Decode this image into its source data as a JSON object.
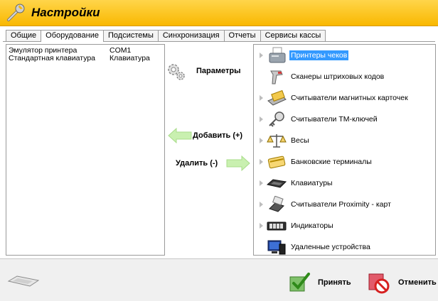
{
  "window": {
    "title": "Настройки"
  },
  "tabs": [
    {
      "label": "Общие",
      "active": false
    },
    {
      "label": "Оборудование",
      "active": true
    },
    {
      "label": "Подсистемы",
      "active": false
    },
    {
      "label": "Синхронизация",
      "active": false
    },
    {
      "label": "Отчеты",
      "active": false
    },
    {
      "label": "Сервисы кассы",
      "active": false
    }
  ],
  "devices": [
    {
      "name": "Эмулятор принтера",
      "port": "COM1"
    },
    {
      "name": "Стандартная клавиатура",
      "port": "Клавиатура"
    }
  ],
  "actions": {
    "params": "Параметры",
    "add": "Добавить (+)",
    "remove": "Удалить (-)"
  },
  "categories": [
    {
      "label": "Принтеры чеков",
      "icon": "receipt-printer-icon",
      "selected": true
    },
    {
      "label": "Сканеры штриховых кодов",
      "icon": "barcode-scanner-icon",
      "selected": false
    },
    {
      "label": "Считыватели магнитных карточек",
      "icon": "magnetic-card-reader-icon",
      "selected": false
    },
    {
      "label": "Считыватели ТМ-ключей",
      "icon": "tm-key-icon",
      "selected": false
    },
    {
      "label": "Весы",
      "icon": "scales-icon",
      "selected": false
    },
    {
      "label": "Банковские терминалы",
      "icon": "bank-card-icon",
      "selected": false
    },
    {
      "label": "Клавиатуры",
      "icon": "keyboard-icon",
      "selected": false
    },
    {
      "label": "Считыватели Proximity - карт",
      "icon": "proximity-card-icon",
      "selected": false
    },
    {
      "label": "Индикаторы",
      "icon": "display-indicator-icon",
      "selected": false
    },
    {
      "label": "Удаленные устройства",
      "icon": "remote-devices-icon",
      "selected": false
    }
  ],
  "footer": {
    "accept": "Принять",
    "cancel": "Отменить"
  },
  "colors": {
    "titlebar": "#f9b800",
    "selection": "#3399ff",
    "arrow": "#b9ec9a"
  }
}
